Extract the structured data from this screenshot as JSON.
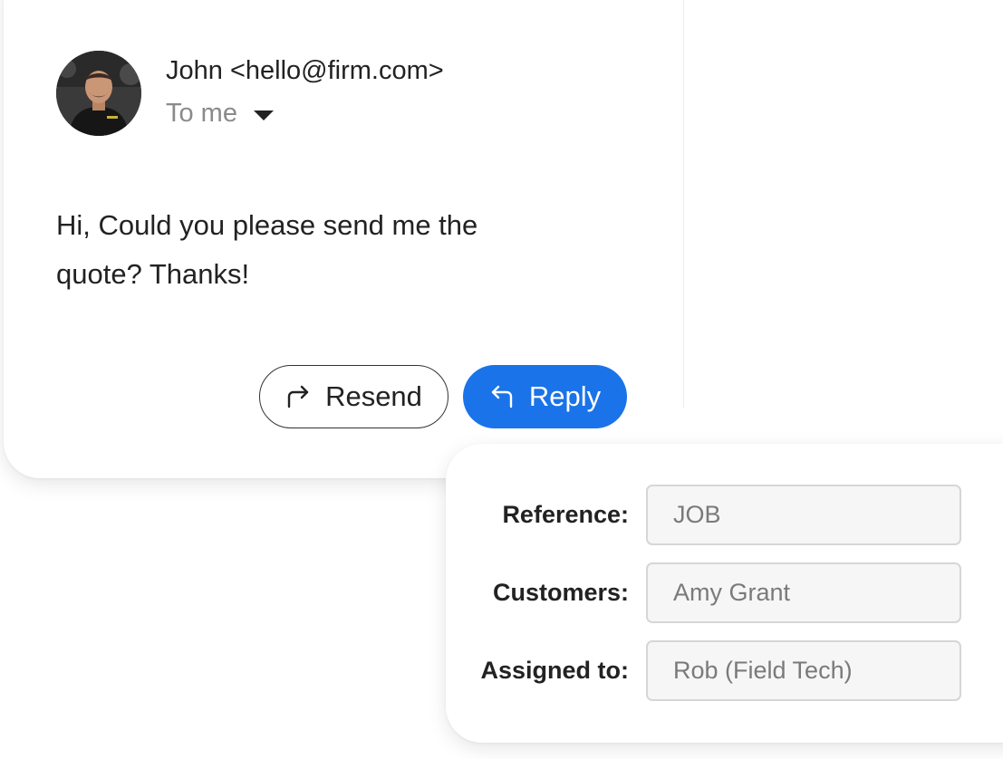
{
  "email": {
    "sender": "John <hello@firm.com>",
    "recipient": "To me",
    "message": "Hi, Could you please send me the quote? Thanks!",
    "resend_label": "Resend",
    "reply_label": "Reply",
    "icons": {
      "avatar": "sender-avatar-photo",
      "recipient_toggle": "caret-down-icon",
      "resend": "forward-arrow-icon",
      "reply": "reply-arrow-icon"
    }
  },
  "job_form": {
    "fields": [
      {
        "label": "Reference:",
        "value": "JOB"
      },
      {
        "label": "Customers:",
        "value": "Amy Grant"
      },
      {
        "label": "Assigned to:",
        "value": "Rob (Field Tech)"
      }
    ]
  },
  "colors": {
    "primary_button": "#1a73e8",
    "input_background": "#f6f6f6",
    "muted_text": "#8a8a8a"
  }
}
